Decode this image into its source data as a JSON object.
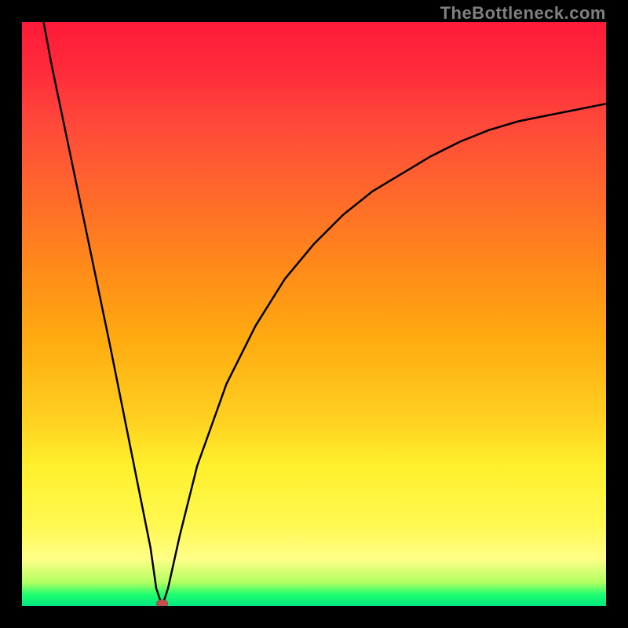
{
  "watermark": "TheBottleneck.com",
  "chart_data": {
    "type": "line",
    "title": "",
    "xlabel": "",
    "ylabel": "",
    "xlim": [
      0,
      100
    ],
    "ylim": [
      0,
      100
    ],
    "x": [
      3.7,
      5,
      10,
      15,
      20,
      22,
      23,
      24,
      25,
      27,
      30,
      35,
      40,
      45,
      50,
      55,
      60,
      65,
      70,
      75,
      80,
      85,
      90,
      95,
      100
    ],
    "values": [
      100,
      93,
      69,
      45,
      20,
      10,
      3,
      0,
      3,
      12,
      24,
      38,
      48,
      56,
      62,
      67,
      71,
      74,
      77,
      79.5,
      81.5,
      83,
      84,
      85,
      86
    ],
    "marker": {
      "x": 24,
      "y": 0
    },
    "grid": false,
    "background_gradient": {
      "top_color": "#ff1a3a",
      "bottom_color": "#00e880",
      "stops": [
        "red",
        "orange",
        "yellow",
        "green"
      ]
    }
  }
}
